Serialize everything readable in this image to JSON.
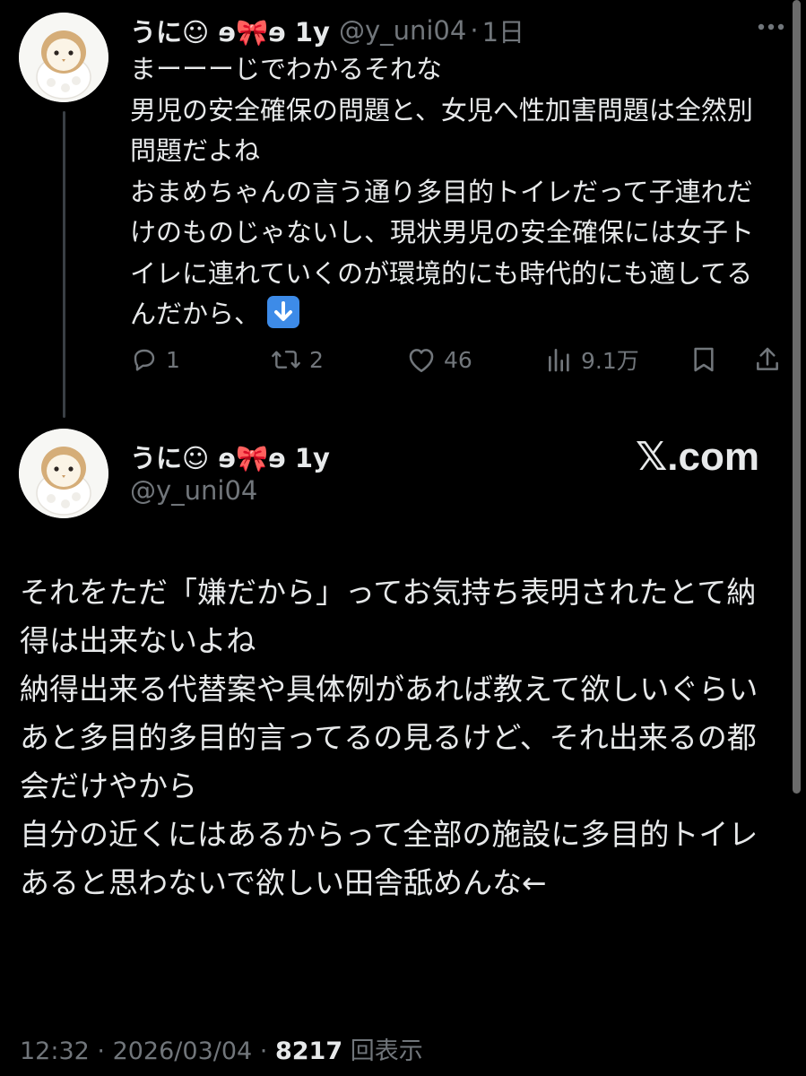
{
  "reply_tweet": {
    "display_name": "うに☺︎ ɘ🎀ɘ 1y",
    "handle": "@y_uni04",
    "time": "1日",
    "body": "まーーーじでわかるそれな\n男児の安全確保の問題と、女児へ性加害問題は全然別問題だよね\nおまめちゃんの言う通り多目的トイレだって子連れだけのものじゃないし、現状男児の安全確保には女子トイレに連れていくのが環境的にも時代的にも適してるんだから、",
    "actions": {
      "replies": "1",
      "reposts": "2",
      "likes": "46",
      "views": "9.1万"
    }
  },
  "main_tweet": {
    "display_name": "うに☺︎ ɘ🎀ɘ 1y",
    "handle": "@y_uni04",
    "brand": "𝕏.com",
    "body": "それをただ「嫌だから」ってお気持ち表明されたとて納得は出来ないよね\n納得出来る代替案や具体例があれば教えて欲しいぐらい\nあと多目的多目的言ってるの見るけど、それ出来るの都会だけやから\n自分の近くにはあるからって全部の施設に多目的トイレあると思わないで欲しい田舎舐めんな←",
    "time": "12:32",
    "date": "2026/03/04",
    "views_count": "8217",
    "views_label": "回表示"
  },
  "icons": {
    "more": "more-icon",
    "reply": "reply-icon",
    "repost": "repost-icon",
    "like": "heart-icon",
    "views": "views-chart-icon",
    "bookmark": "bookmark-icon",
    "share": "share-icon",
    "emoji": "down-arrow-emoji"
  },
  "colors": {
    "background": "#000000",
    "text": "#e7e9ea",
    "muted": "#71767b",
    "emoji_blue": "#3d8be8"
  }
}
